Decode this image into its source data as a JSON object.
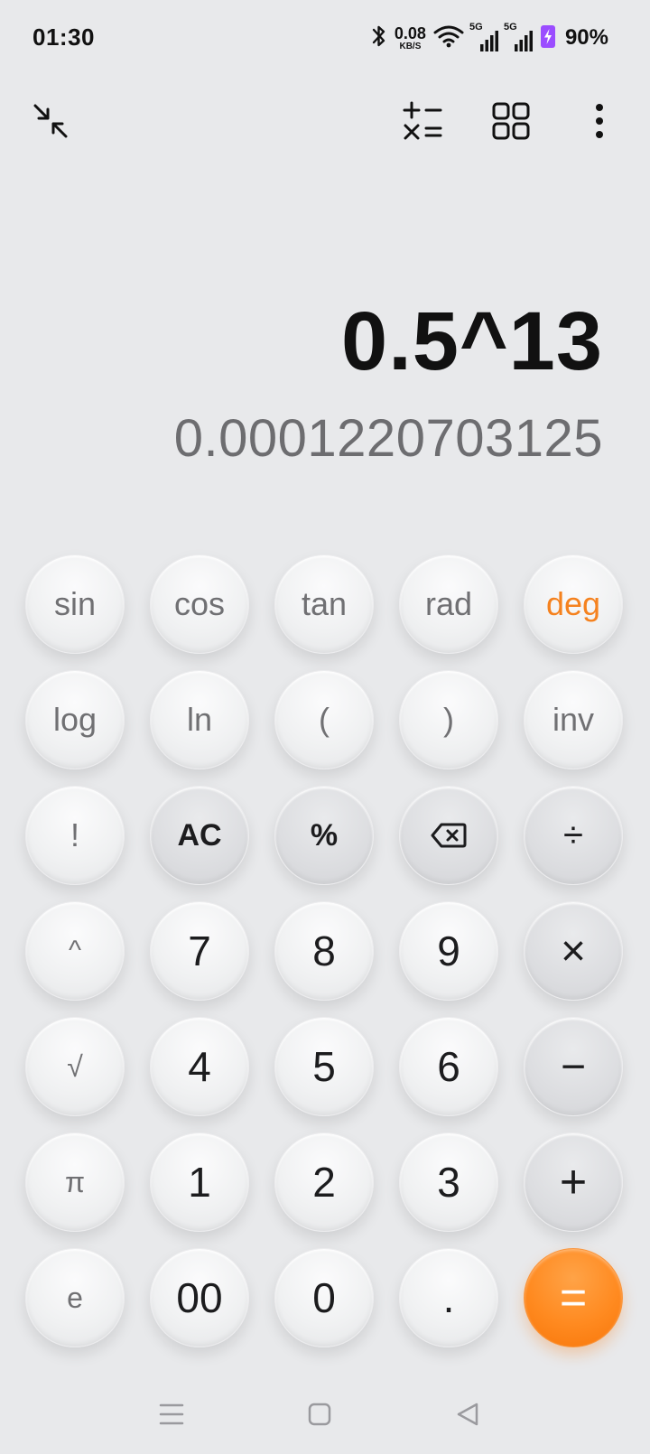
{
  "status_bar": {
    "time": "01:30",
    "net_speed_value": "0.08",
    "net_speed_unit": "KB/S",
    "sim1_tag": "5G",
    "sim2_tag": "5G",
    "battery_percent": "90%"
  },
  "toolbar": {
    "icons": [
      "collapse-icon",
      "unit-converter-icon",
      "apps-grid-icon",
      "more-vert-icon"
    ]
  },
  "display": {
    "expression": "0.5^13",
    "result": "0.0001220703125"
  },
  "keys": {
    "sin": "sin",
    "cos": "cos",
    "tan": "tan",
    "rad": "rad",
    "deg": "deg",
    "log": "log",
    "ln": "ln",
    "lparen": "(",
    "rparen": ")",
    "inv": "inv",
    "factorial": "!",
    "ac": "AC",
    "percent": "%",
    "divide": "÷",
    "power": "^",
    "seven": "7",
    "eight": "8",
    "nine": "9",
    "multiply": "×",
    "sqrt": "√",
    "four": "4",
    "five": "5",
    "six": "6",
    "minus": "−",
    "pi": "π",
    "one": "1",
    "two": "2",
    "three": "3",
    "plus": "+",
    "e": "e",
    "double_zero": "00",
    "zero": "0",
    "decimal": ".",
    "equals": "="
  },
  "colors": {
    "background": "#e8e9eb",
    "accent": "#f5821f",
    "equals": "#ff8a20",
    "battery": "#9b4dff"
  }
}
